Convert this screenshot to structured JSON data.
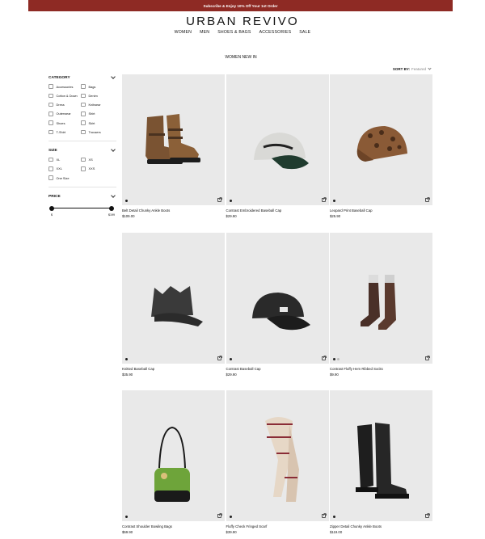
{
  "promo": {
    "text": "Subscribe & Enjoy 10% Off Your 1st Order"
  },
  "brand": {
    "logo": "URBAN REVIVO"
  },
  "nav": [
    "WOMEN",
    "MEN",
    "SHOES & BAGS",
    "ACCESSORIES",
    "SALE"
  ],
  "page": {
    "title": "WOMEN NEW IN"
  },
  "sort": {
    "label": "SORT BY:",
    "value": "Featured"
  },
  "filters": {
    "category": {
      "title": "CATEGORY",
      "options": [
        "Accessories",
        "Bags",
        "Cotton & Down",
        "Denim",
        "Dress",
        "Knitwear",
        "Outerwear",
        "Shirt",
        "Shoes",
        "Skirt",
        "T-Shirt",
        "Trousers"
      ]
    },
    "size": {
      "title": "SIZE",
      "options": [
        "XL",
        "XS",
        "XXL",
        "XXS",
        "One Size"
      ]
    },
    "price": {
      "title": "PRICE",
      "min_label": "$",
      "max_label": "$199",
      "selected_min_fraction": 0,
      "selected_max_fraction": 1
    }
  },
  "colors": {
    "promo_bg": "#8e2a24",
    "tile_bg": "#e9e9e9"
  },
  "products": [
    {
      "name": "Belt Detail Chunky Ankle Boots",
      "price": "$109.00",
      "icon": "ankle-boot-icon",
      "swatches": 1
    },
    {
      "name": "Contrast Embroidered Baseball Cap",
      "price": "$29.90",
      "icon": "baseball-cap-icon",
      "swatches": 1
    },
    {
      "name": "Leopard Print Baseball Cap",
      "price": "$25.90",
      "icon": "leopard-cap-icon",
      "swatches": 1
    },
    {
      "name": "Knitted Baseball Cap",
      "price": "$35.90",
      "icon": "knit-cap-icon",
      "swatches": 1
    },
    {
      "name": "Contrast Baseball Cap",
      "price": "$29.90",
      "icon": "black-cap-icon",
      "swatches": 1
    },
    {
      "name": "Contrast Fluffy Hem Ribbed Socks",
      "price": "$9.90",
      "icon": "socks-icon",
      "swatches": 2
    },
    {
      "name": "Contrast Shoulder Bowling Bags",
      "price": "$59.90",
      "icon": "bowling-bag-icon",
      "swatches": 1
    },
    {
      "name": "Fluffy Check Fringed Scarf",
      "price": "$39.90",
      "icon": "scarf-icon",
      "swatches": 1
    },
    {
      "name": "Zipper Detail Chunky Ankle Boots",
      "price": "$119.00",
      "icon": "combat-boot-icon",
      "swatches": 1
    }
  ]
}
